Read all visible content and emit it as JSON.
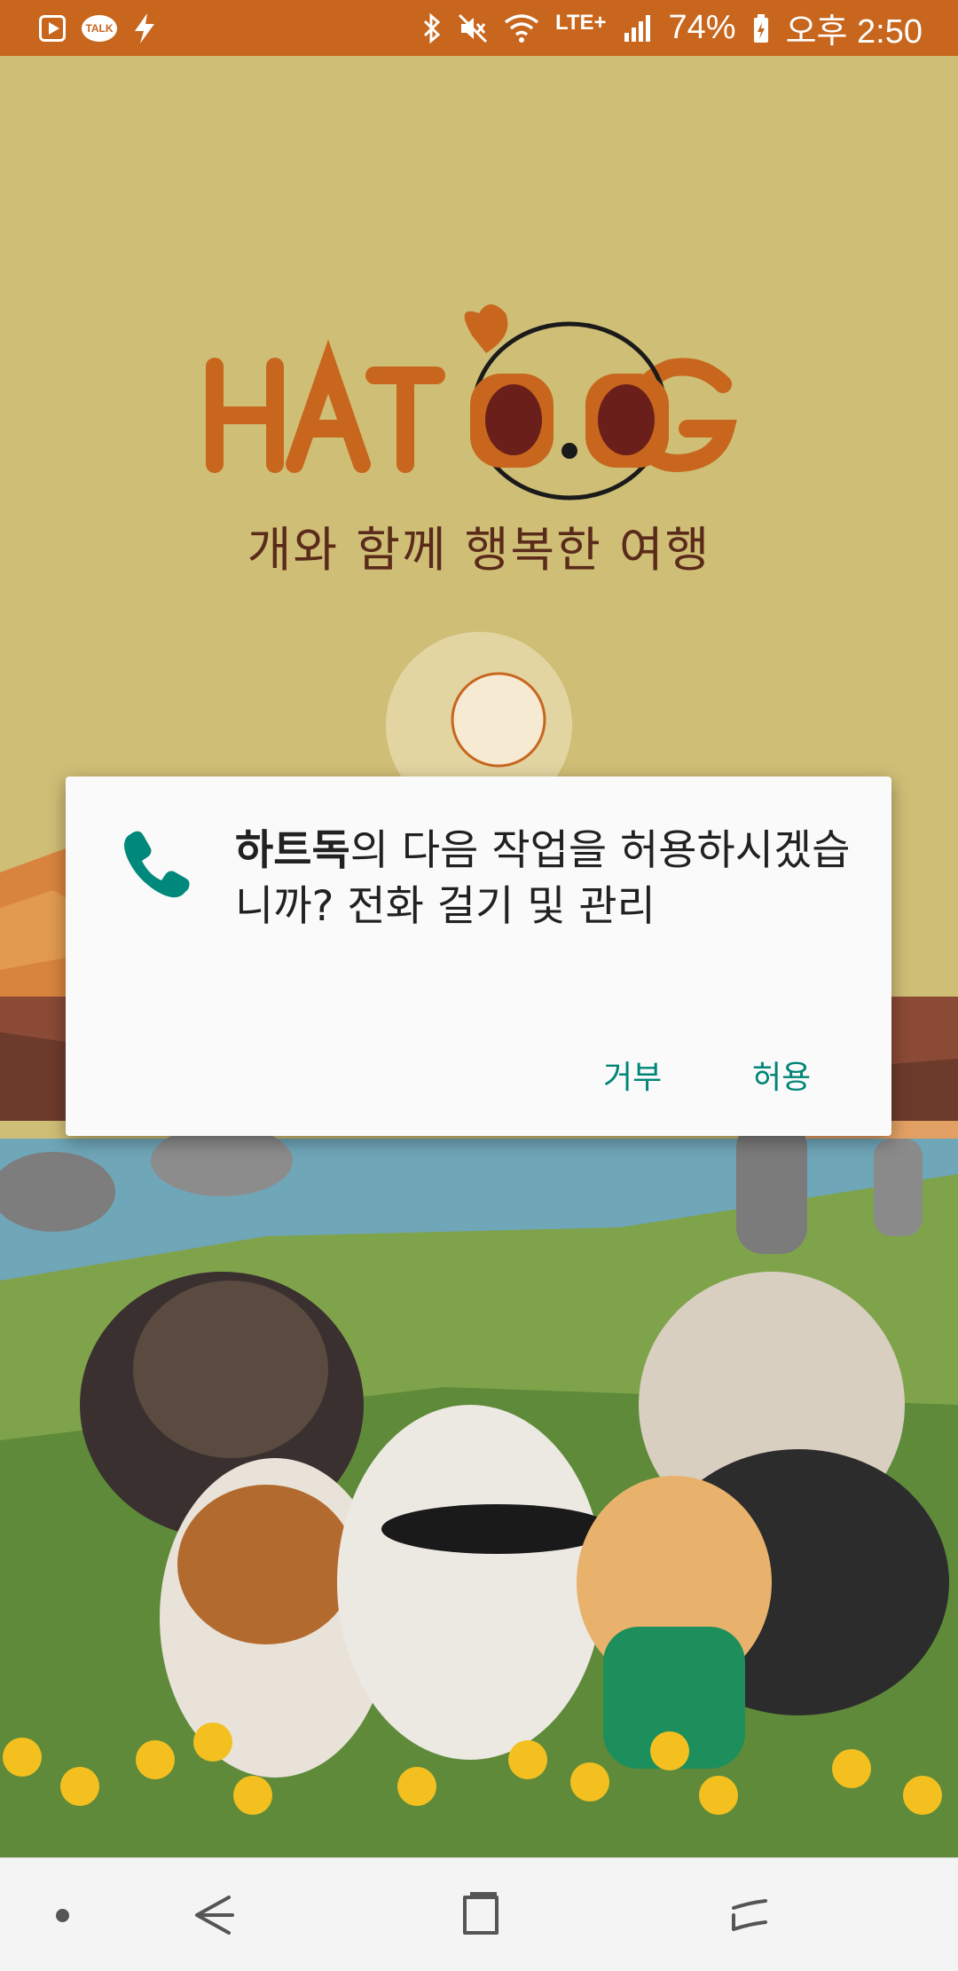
{
  "status_bar": {
    "left_icons": [
      "youtube-icon",
      "kakaotalk-icon",
      "lightning-icon"
    ],
    "talk_label": "TALK",
    "right_icons": [
      "bluetooth-icon",
      "mute-icon",
      "wifi-icon",
      "lte-icon",
      "signal-icon"
    ],
    "network": "LTE+",
    "battery": "74%",
    "time": "오후 2:50"
  },
  "app": {
    "logo_text": "HATDOG",
    "tagline": "개와 함께 행복한 여행",
    "colors": {
      "background": "#cfbe76",
      "logo": "#c8661e",
      "status_bar": "#c8661e"
    }
  },
  "dialog": {
    "icon": "phone-icon",
    "app_name": "하트독",
    "message_rest": "의 다음 작업을 허용하시겠습니까? 전화 걸기 및 관리",
    "deny_label": "거부",
    "allow_label": "허용",
    "accent_color": "#008577"
  },
  "nav_bar": {
    "buttons": [
      "dot-icon",
      "back-icon",
      "home-icon",
      "recents-icon"
    ]
  }
}
